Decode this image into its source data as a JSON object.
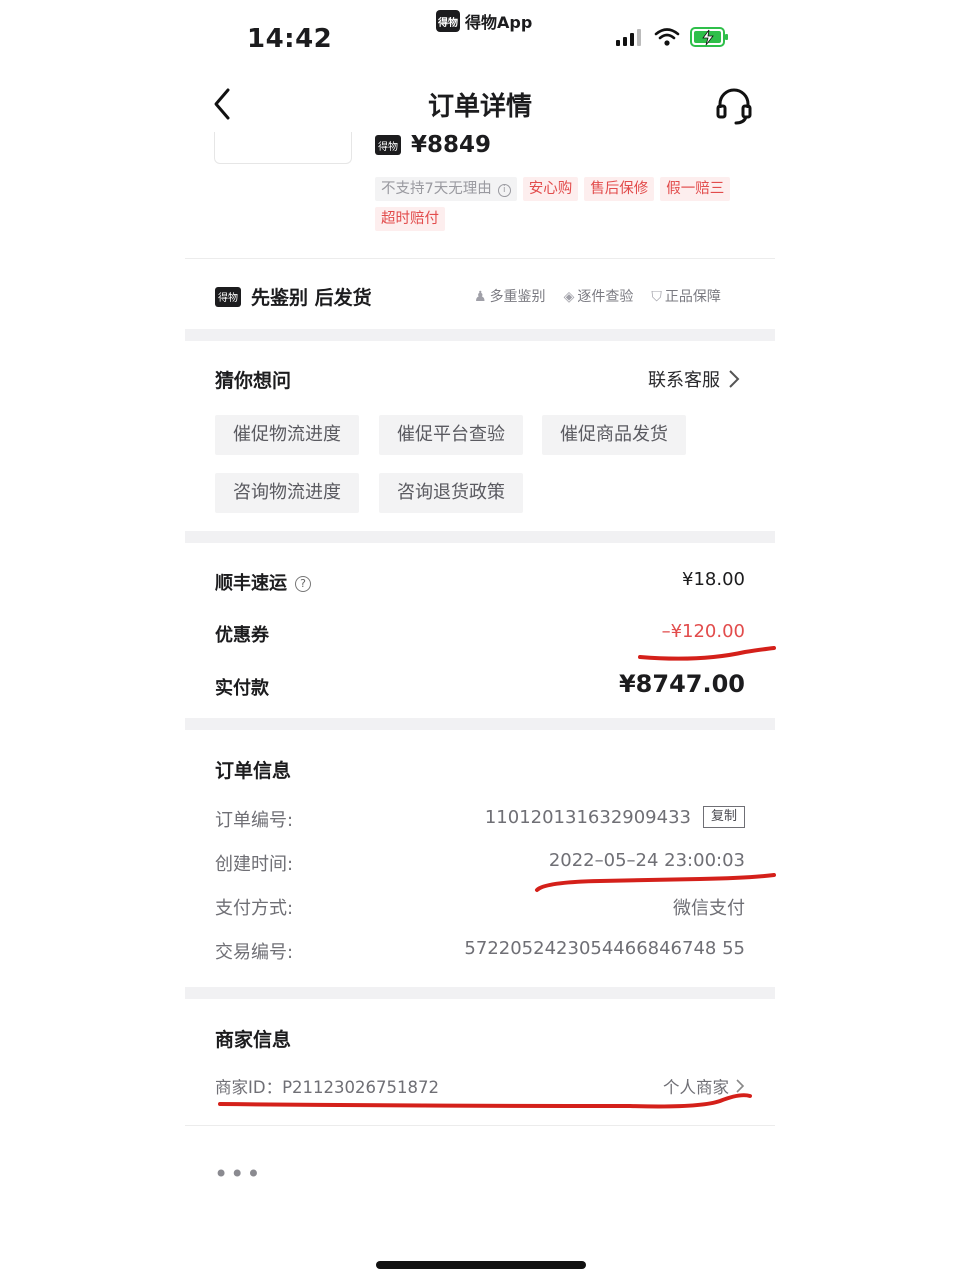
{
  "status_bar": {
    "time": "14:42",
    "app_name": "得物App",
    "app_logo": "得物"
  },
  "nav": {
    "title": "订单详情",
    "back_icon": "chevron-left-icon",
    "service_icon": "headset-icon"
  },
  "product": {
    "logo": "得物",
    "price": "¥8849",
    "tags": [
      {
        "text": "不支持7天无理由",
        "style": "gray"
      },
      {
        "text": "安心购",
        "style": "red"
      },
      {
        "text": "售后保修",
        "style": "red"
      },
      {
        "text": "假一赔三",
        "style": "red"
      },
      {
        "text": "超时赔付",
        "style": "red"
      }
    ]
  },
  "authenticate": {
    "logo": "得物",
    "title": "先鉴别 后发货",
    "features": [
      "多重鉴别",
      "逐件查验",
      "正品保障"
    ]
  },
  "guess": {
    "title": "猜你想问",
    "contact": "联系客服",
    "chips": [
      "催促物流进度",
      "催促平台查验",
      "催促商品发货",
      "咨询物流进度",
      "咨询退货政策"
    ]
  },
  "fees": {
    "shipping_label": "顺丰速运",
    "shipping_value": "¥18.00",
    "coupon_label": "优惠券",
    "coupon_value": "–¥120.00",
    "paid_label": "实付款",
    "paid_value": "¥8747.00"
  },
  "order_info": {
    "title": "订单信息",
    "rows": [
      {
        "label": "订单编号:",
        "value": "110120131632909433"
      },
      {
        "label": "创建时间:",
        "value": "2022–05–24 23:00:03"
      },
      {
        "label": "支付方式:",
        "value": "微信支付"
      },
      {
        "label": "交易编号:",
        "value": "5722052423054466846748 55"
      }
    ],
    "copy_label": "复制"
  },
  "merchant": {
    "title": "商家信息",
    "id_text": "商家ID：P21123026751872",
    "type": "个人商家"
  },
  "more": "•••",
  "colors": {
    "accent_red": "#e24c4c",
    "annotation_red": "#d4201a"
  }
}
